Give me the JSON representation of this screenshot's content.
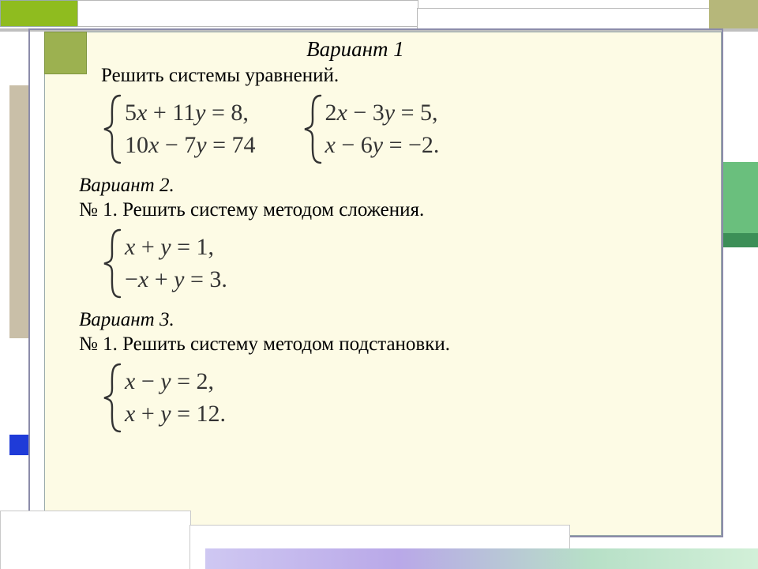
{
  "variant1": {
    "title": "Вариант 1",
    "instruction": "Решить системы  уравнений.",
    "systems": [
      {
        "eq1_lhs": "5",
        "eq1_x": "x",
        "eq1_mid": " + 11",
        "eq1_y": "y",
        "eq1_rhs": " = 8,",
        "eq2_lhs": "10",
        "eq2_x": "x",
        "eq2_mid": " − 7",
        "eq2_y": "y",
        "eq2_rhs": " = 74"
      },
      {
        "eq1_lhs": "2",
        "eq1_x": "x",
        "eq1_mid": " − 3",
        "eq1_y": "y",
        "eq1_rhs": "  = 5,",
        "eq2_lhs": "",
        "eq2_x": "x",
        "eq2_mid": " − 6",
        "eq2_y": "y",
        "eq2_rhs": " = −2."
      }
    ]
  },
  "variant2": {
    "title": "Вариант 2.",
    "task": "№ 1. Решить систему методом сложения.",
    "system": {
      "eq1_lhs": " ",
      "eq1_x": "x",
      "eq1_mid": " + ",
      "eq1_y": "y",
      "eq1_rhs": "  = 1,",
      "eq2_lhs": "−",
      "eq2_x": "x",
      "eq2_mid": " + ",
      "eq2_y": "y",
      "eq2_rhs": " = 3."
    }
  },
  "variant3": {
    "title": "Вариант 3.",
    "task": "№ 1. Решить систему методом подстановки.",
    "system": {
      "eq1_lhs": "",
      "eq1_x": "x",
      "eq1_mid": " − ",
      "eq1_y": "y",
      "eq1_rhs": "  = 2,",
      "eq2_lhs": "",
      "eq2_x": "x",
      "eq2_mid": " + ",
      "eq2_y": "y",
      "eq2_rhs": " = 12."
    }
  }
}
